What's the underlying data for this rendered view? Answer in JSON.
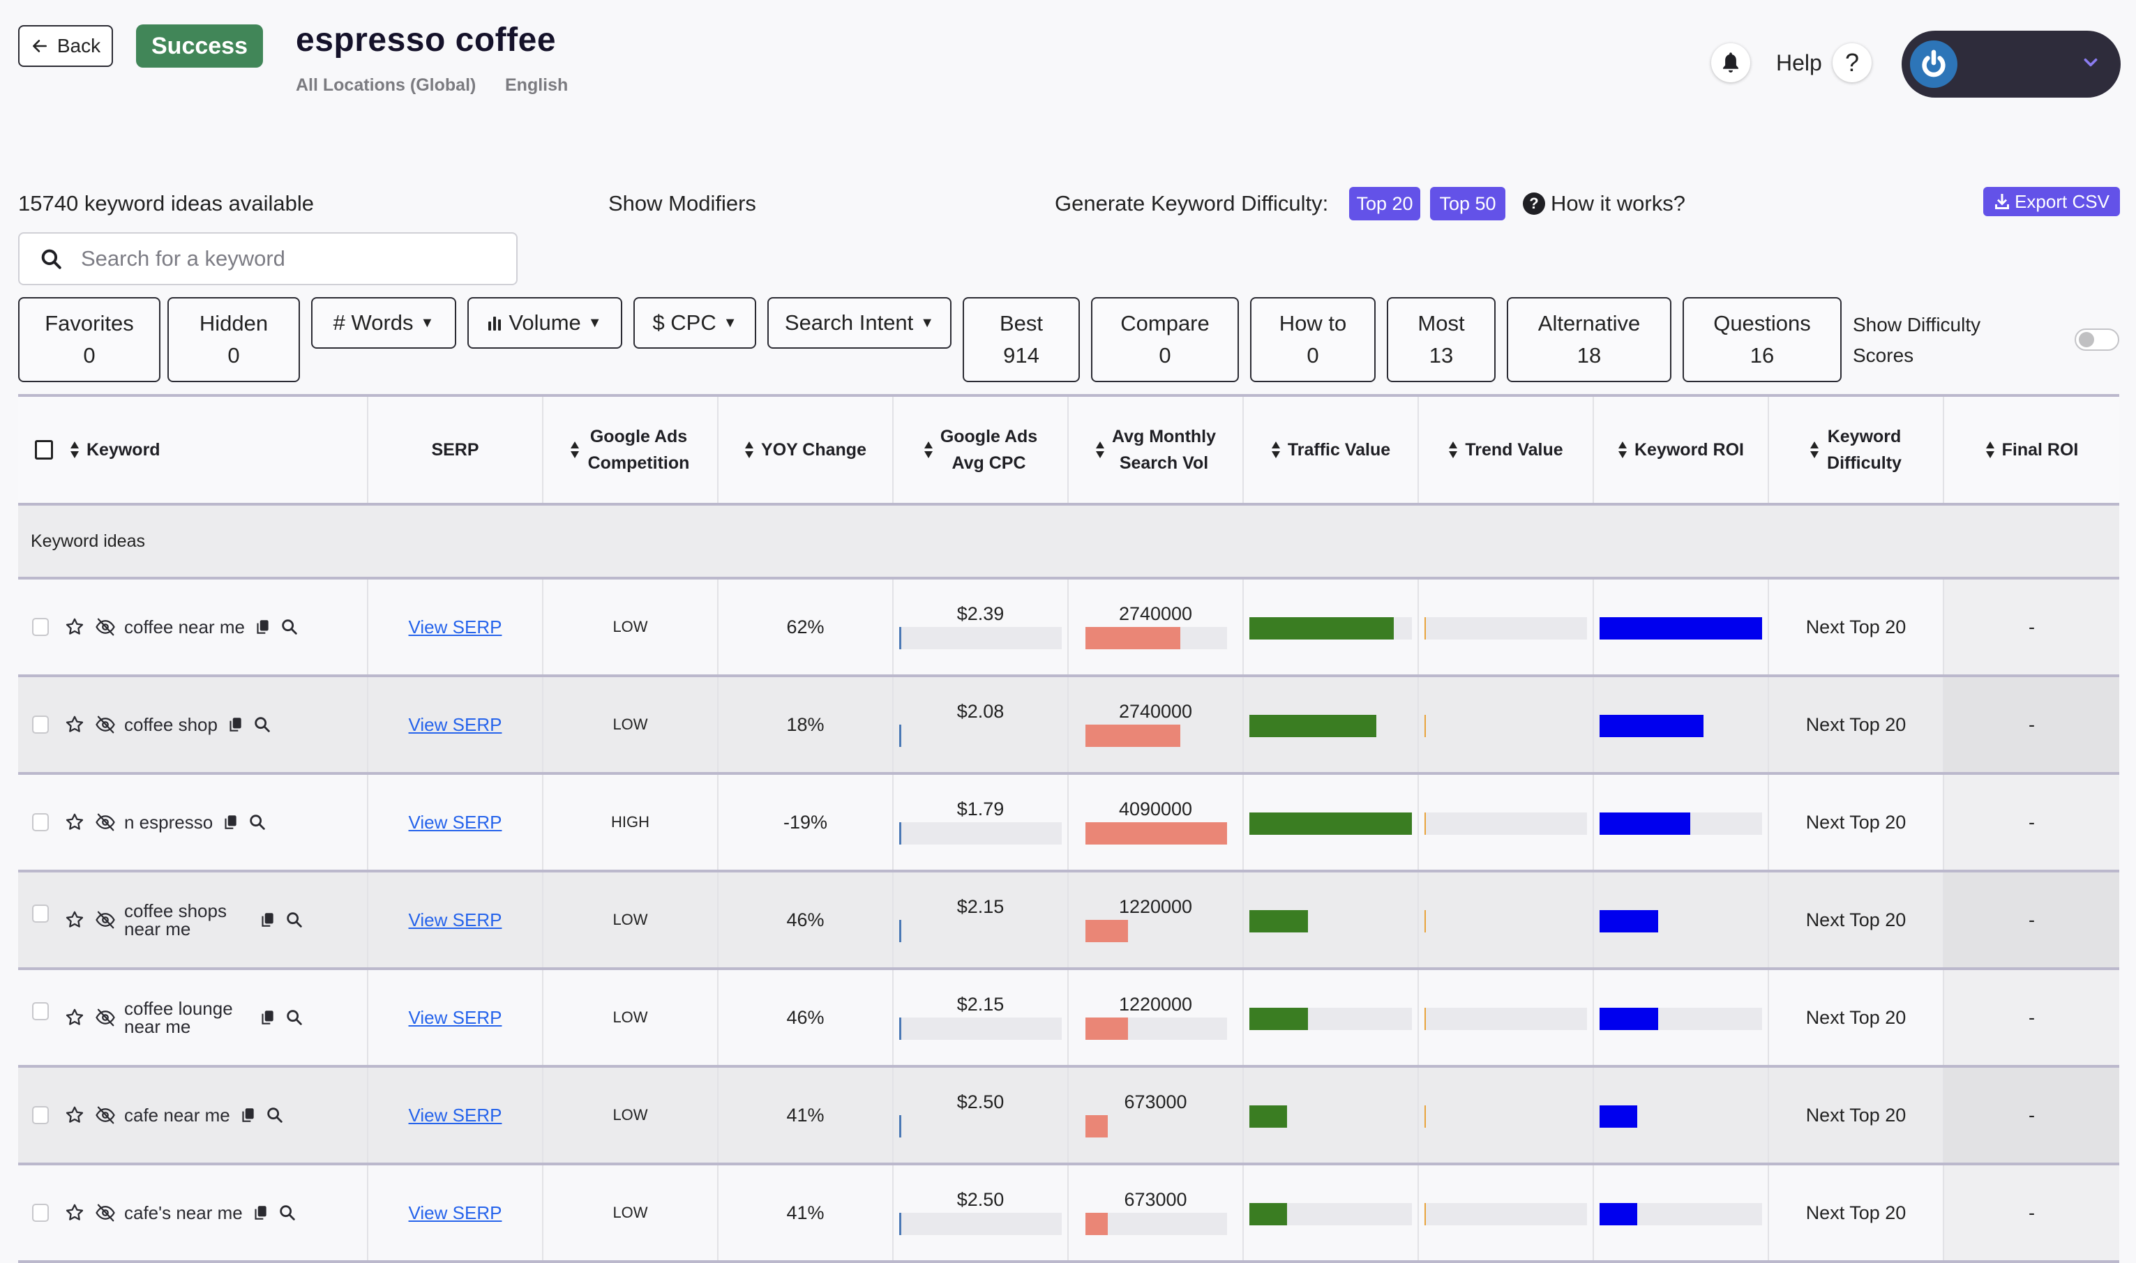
{
  "header": {
    "back_label": "Back",
    "status": "Success",
    "title": "espresso coffee",
    "location": "All Locations (Global)",
    "language": "English",
    "help_label": "Help",
    "help_icon": "?",
    "icons": {
      "back": "arrow-left-icon",
      "notifications": "bell-icon",
      "avatar": "power-logo-icon",
      "menu": "chevron-down-icon"
    }
  },
  "toolbar": {
    "count_label": "15740 keyword ideas available",
    "modifiers_label": "Show Modifiers",
    "kd_label": "Generate Keyword Difficulty:",
    "kd_buttons": [
      "Top 20",
      "Top 50"
    ],
    "how_it_works": "How it works?",
    "export_label": "Export CSV",
    "search_placeholder": "Search for a keyword",
    "search_value": "",
    "filters": [
      {
        "label": "Favorites",
        "count": "0"
      },
      {
        "label": "Hidden",
        "count": "0"
      },
      {
        "label": "# Words",
        "dropdown": true
      },
      {
        "label": "Volume",
        "dropdown": true,
        "icon": "bar-chart-icon"
      },
      {
        "label": "$ CPC",
        "dropdown": true
      },
      {
        "label": "Search Intent",
        "dropdown": true
      },
      {
        "label": "Best",
        "count": "914"
      },
      {
        "label": "Compare",
        "count": "0"
      },
      {
        "label": "How to",
        "count": "0"
      },
      {
        "label": "Most",
        "count": "13"
      },
      {
        "label": "Alternative",
        "count": "18"
      },
      {
        "label": "Questions",
        "count": "16"
      }
    ],
    "difficulty_toggle_label_1": "Show Difficulty",
    "difficulty_toggle_label_2": "Scores",
    "difficulty_toggle_on": false
  },
  "table": {
    "columns": [
      {
        "label": "Keyword",
        "sortable": true
      },
      {
        "label": "SERP",
        "sortable": false
      },
      {
        "label": "Google Ads Competition",
        "sortable": true
      },
      {
        "label": "YOY Change",
        "sortable": true
      },
      {
        "label": "Google Ads Avg CPC",
        "sortable": true
      },
      {
        "label": "Avg Monthly Search Vol",
        "sortable": true
      },
      {
        "label": "Traffic Value",
        "sortable": true
      },
      {
        "label": "Trend Value",
        "sortable": true
      },
      {
        "label": "Keyword ROI",
        "sortable": true
      },
      {
        "label": "Keyword Difficulty",
        "sortable": true
      },
      {
        "label": "Final ROI",
        "sortable": true
      }
    ],
    "group_label": "Keyword ideas",
    "serp_link_label": "View SERP",
    "colors": {
      "cpc": "#4a78b5",
      "volume": "#ea8676",
      "traffic": "#3a7d22",
      "trend": "#e8a33b",
      "roi": "#0000ee"
    },
    "rows": [
      {
        "keyword": "coffee near me",
        "competition": "LOW",
        "yoy": "62%",
        "cpc": "$2.39",
        "cpc_frac": 0.01,
        "volume": "2740000",
        "volume_frac": 0.67,
        "traffic_frac": 0.89,
        "trend_frac": 0.0,
        "roi_frac": 1.0,
        "difficulty": "Next Top 20",
        "final_roi": "-",
        "track": true
      },
      {
        "keyword": "coffee shop",
        "competition": "LOW",
        "yoy": "18%",
        "cpc": "$2.08",
        "cpc_frac": 0.01,
        "volume": "2740000",
        "volume_frac": 0.67,
        "traffic_frac": 0.78,
        "trend_frac": 0.0,
        "roi_frac": 0.64,
        "difficulty": "Next Top 20",
        "final_roi": "-",
        "track": false
      },
      {
        "keyword": "n espresso",
        "competition": "HIGH",
        "yoy": "-19%",
        "cpc": "$1.79",
        "cpc_frac": 0.01,
        "volume": "4090000",
        "volume_frac": 1.0,
        "traffic_frac": 1.0,
        "trend_frac": 0.0,
        "roi_frac": 0.56,
        "difficulty": "Next Top 20",
        "final_roi": "-",
        "track": true
      },
      {
        "keyword": "coffee shops near me",
        "competition": "LOW",
        "yoy": "46%",
        "cpc": "$2.15",
        "cpc_frac": 0.01,
        "volume": "1220000",
        "volume_frac": 0.3,
        "traffic_frac": 0.36,
        "trend_frac": 0.0,
        "roi_frac": 0.36,
        "difficulty": "Next Top 20",
        "final_roi": "-",
        "track": false
      },
      {
        "keyword": "coffee lounge near me",
        "competition": "LOW",
        "yoy": "46%",
        "cpc": "$2.15",
        "cpc_frac": 0.01,
        "volume": "1220000",
        "volume_frac": 0.3,
        "traffic_frac": 0.36,
        "trend_frac": 0.0,
        "roi_frac": 0.36,
        "difficulty": "Next Top 20",
        "final_roi": "-",
        "track": true
      },
      {
        "keyword": "cafe near me",
        "competition": "LOW",
        "yoy": "41%",
        "cpc": "$2.50",
        "cpc_frac": 0.01,
        "volume": "673000",
        "volume_frac": 0.16,
        "traffic_frac": 0.23,
        "trend_frac": 0.0,
        "roi_frac": 0.23,
        "difficulty": "Next Top 20",
        "final_roi": "-",
        "track": false
      },
      {
        "keyword": "cafe's near me",
        "competition": "LOW",
        "yoy": "41%",
        "cpc": "$2.50",
        "cpc_frac": 0.01,
        "volume": "673000",
        "volume_frac": 0.16,
        "traffic_frac": 0.23,
        "trend_frac": 0.0,
        "roi_frac": 0.23,
        "difficulty": "Next Top 20",
        "final_roi": "-",
        "track": true
      }
    ]
  }
}
